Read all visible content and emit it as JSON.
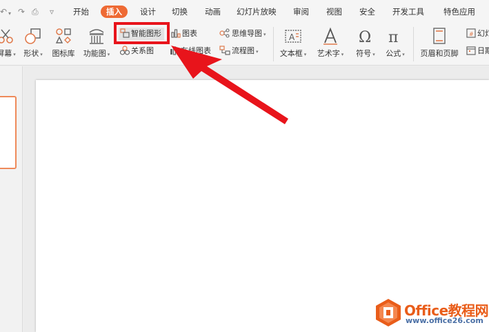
{
  "quick_access": {
    "undo": "↶",
    "redo": "↷",
    "print": "⎙",
    "more": "▿"
  },
  "menu": {
    "tabs": [
      "开始",
      "插入",
      "设计",
      "切换",
      "动画",
      "幻灯片放映",
      "审阅",
      "视图",
      "安全",
      "开发工具",
      "特色应用"
    ],
    "active": "插入"
  },
  "ribbon": {
    "screenshot": "屏幕",
    "shapes": "形状",
    "icon_library": "图标库",
    "function_chart": "功能图",
    "smart_art": "智能图形",
    "relation_chart": "关系图",
    "chart": "图表",
    "online_chart": "在线图表",
    "mind_map": "思维导图",
    "flowchart": "流程图",
    "text_box": "文本框",
    "word_art": "艺术字",
    "symbol": "符号",
    "formula": "公式",
    "header_footer": "页眉和页脚",
    "slide_number": "幻灯",
    "date": "日期"
  },
  "watermark": {
    "brand": "Office教程网",
    "url": "www.office26.com"
  },
  "colors": {
    "accent": "#ee6a34",
    "highlight": "#e8141b",
    "brand": "#e95d1a"
  }
}
